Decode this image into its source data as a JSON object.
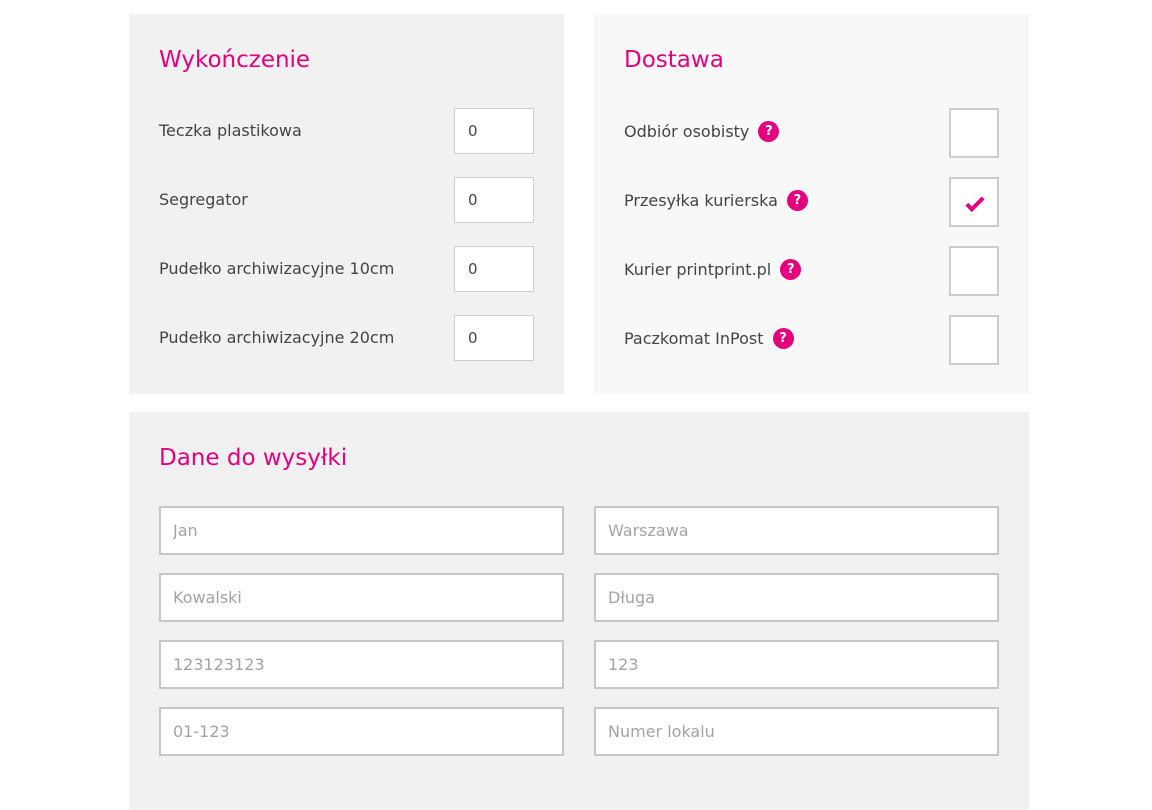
{
  "finish": {
    "title": "Wykończenie",
    "items": [
      {
        "label": "Teczka plastikowa",
        "value": "0"
      },
      {
        "label": "Segregator",
        "value": "0"
      },
      {
        "label": "Pudełko archiwizacyjne 10cm",
        "value": "0"
      },
      {
        "label": "Pudełko archiwizacyjne 20cm",
        "value": "0"
      }
    ]
  },
  "delivery": {
    "title": "Dostawa",
    "help_glyph": "?",
    "options": [
      {
        "label": "Odbiór osobisty",
        "checked": false
      },
      {
        "label": "Przesyłka kurierska",
        "checked": true
      },
      {
        "label": "Kurier printprint.pl",
        "checked": false
      },
      {
        "label": "Paczkomat InPost",
        "checked": false
      }
    ]
  },
  "shipping": {
    "title": "Dane do wysyłki",
    "fields": {
      "first_name": {
        "placeholder": "Jan"
      },
      "city": {
        "placeholder": "Warszawa"
      },
      "last_name": {
        "placeholder": "Kowalski"
      },
      "street": {
        "placeholder": "Długa"
      },
      "phone": {
        "placeholder": "123123123"
      },
      "house_number": {
        "placeholder": "123"
      },
      "postal_code": {
        "placeholder": "01-123"
      },
      "apartment_number": {
        "placeholder": "Numer lokalu"
      }
    }
  },
  "colors": {
    "accent": "#e5007e",
    "panel_bg": "#f1f1f1",
    "panel_bg_light": "#f8f8f8"
  }
}
